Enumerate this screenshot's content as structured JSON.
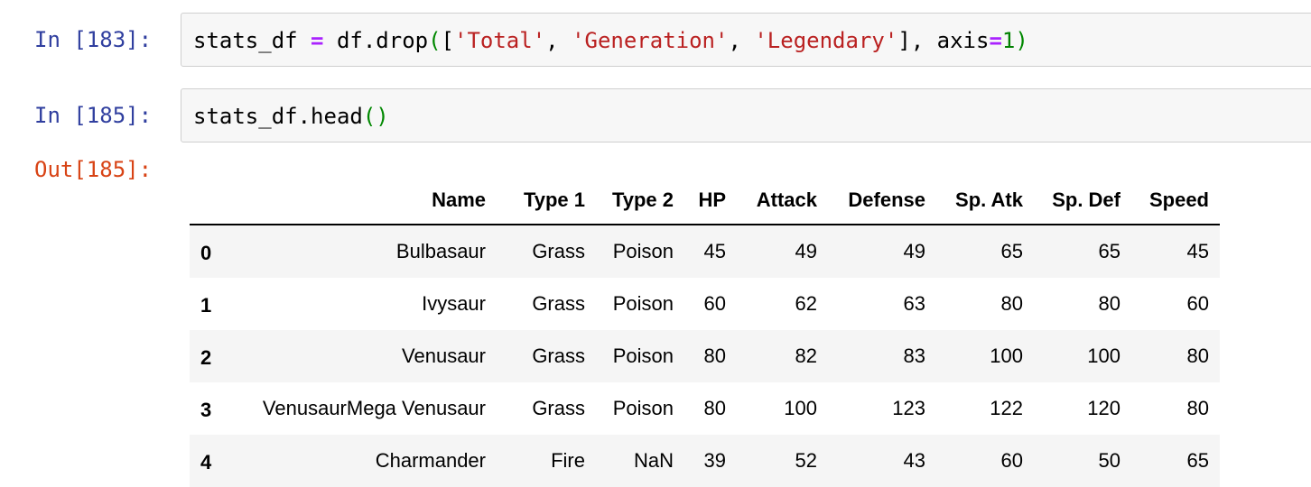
{
  "cells": [
    {
      "prompt": "In [183]:",
      "code_tokens": [
        {
          "text": "stats_df ",
          "kind": "plain"
        },
        {
          "text": "=",
          "kind": "op"
        },
        {
          "text": " df.drop",
          "kind": "plain"
        },
        {
          "text": "(",
          "kind": "paren"
        },
        {
          "text": "[",
          "kind": "plain"
        },
        {
          "text": "'Total'",
          "kind": "str"
        },
        {
          "text": ", ",
          "kind": "plain"
        },
        {
          "text": "'Generation'",
          "kind": "str"
        },
        {
          "text": ", ",
          "kind": "plain"
        },
        {
          "text": "'Legendary'",
          "kind": "str"
        },
        {
          "text": "], axis",
          "kind": "plain"
        },
        {
          "text": "=",
          "kind": "op"
        },
        {
          "text": "1",
          "kind": "num"
        },
        {
          "text": ")",
          "kind": "paren"
        }
      ]
    },
    {
      "prompt": "In [185]:",
      "code_tokens": [
        {
          "text": "stats_df.head",
          "kind": "plain"
        },
        {
          "text": "()",
          "kind": "paren"
        }
      ]
    }
  ],
  "output": {
    "prompt": "Out[185]:",
    "columns": [
      "",
      "Name",
      "Type 1",
      "Type 2",
      "HP",
      "Attack",
      "Defense",
      "Sp. Atk",
      "Sp. Def",
      "Speed"
    ],
    "rows": [
      [
        "0",
        "Bulbasaur",
        "Grass",
        "Poison",
        "45",
        "49",
        "49",
        "65",
        "65",
        "45"
      ],
      [
        "1",
        "Ivysaur",
        "Grass",
        "Poison",
        "60",
        "62",
        "63",
        "80",
        "80",
        "60"
      ],
      [
        "2",
        "Venusaur",
        "Grass",
        "Poison",
        "80",
        "82",
        "83",
        "100",
        "100",
        "80"
      ],
      [
        "3",
        "VenusaurMega Venusaur",
        "Grass",
        "Poison",
        "80",
        "100",
        "123",
        "122",
        "120",
        "80"
      ],
      [
        "4",
        "Charmander",
        "Fire",
        "NaN",
        "39",
        "52",
        "43",
        "60",
        "50",
        "65"
      ]
    ]
  },
  "colors": {
    "in_prompt": "#303f9f",
    "out_prompt": "#d84315",
    "operator": "#aa22ff",
    "string": "#ba2121",
    "number": "#008000",
    "paren": "#008800"
  }
}
